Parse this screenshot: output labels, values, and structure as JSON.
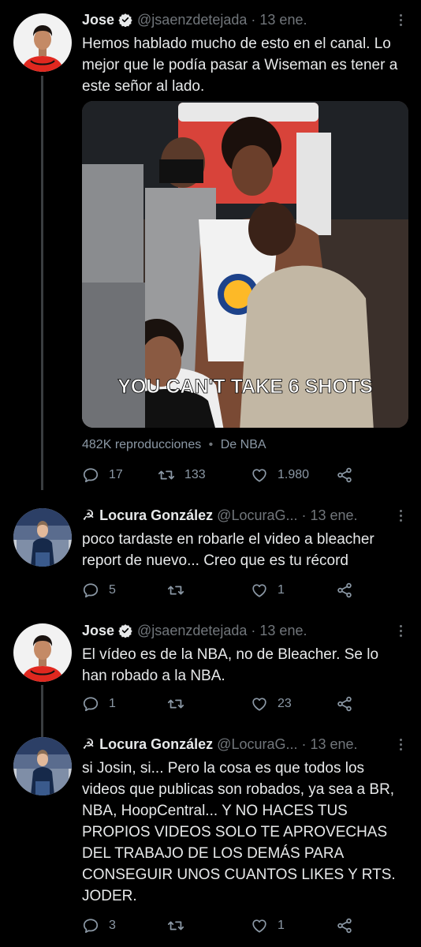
{
  "tweets": [
    {
      "name": "Jose",
      "handle": "@jsaenzdetejada",
      "time": "13 ene.",
      "text": "Hemos hablado mucho de esto en el canal. Lo mejor que le podía pasar a Wiseman es tener a este señor al lado.",
      "verified": true,
      "video_caption": "YOU CAN'T TAKE 6 SHOTS",
      "views": "482K reproducciones",
      "source": "De NBA",
      "replies": "17",
      "retweets": "133",
      "likes": "1.980"
    },
    {
      "name": "Locura González",
      "name_prefix": "☭",
      "handle": "@LocuraG...",
      "time": "13 ene.",
      "text": "poco tardaste en robarle el video a bleacher report de nuevo... Creo que es tu récord",
      "replies": "5",
      "retweets": "",
      "likes": "1"
    },
    {
      "name": "Jose",
      "handle": "@jsaenzdetejada",
      "time": "13 ene.",
      "verified": true,
      "text": "El vídeo es de la NBA, no de Bleacher. Se lo han robado a la NBA.",
      "replies": "1",
      "retweets": "",
      "likes": "23"
    },
    {
      "name": "Locura González",
      "name_prefix": "☭",
      "handle": "@LocuraG...",
      "time": "13 ene.",
      "text": "si Josin, si... Pero la cosa es que todos los videos que publicas son robados, ya sea a BR, NBA, HoopCentral... Y NO HACES TUS PROPIOS VIDEOS SOLO TE APROVECHAS DEL TRABAJO DE LOS DEMÁS PARA CONSEGUIR UNOS CUANTOS LIKES Y RTS. JODER.",
      "replies": "3",
      "retweets": "",
      "likes": "1"
    }
  ],
  "colors": {
    "background": "#000000",
    "text": "#e7e9ea",
    "secondary": "#71767b",
    "verified": "#e7e9ea",
    "thread_line": "#3a3d40"
  },
  "icons": [
    "reply-icon",
    "retweet-icon",
    "like-icon",
    "share-icon",
    "verified-icon",
    "more-icon"
  ]
}
